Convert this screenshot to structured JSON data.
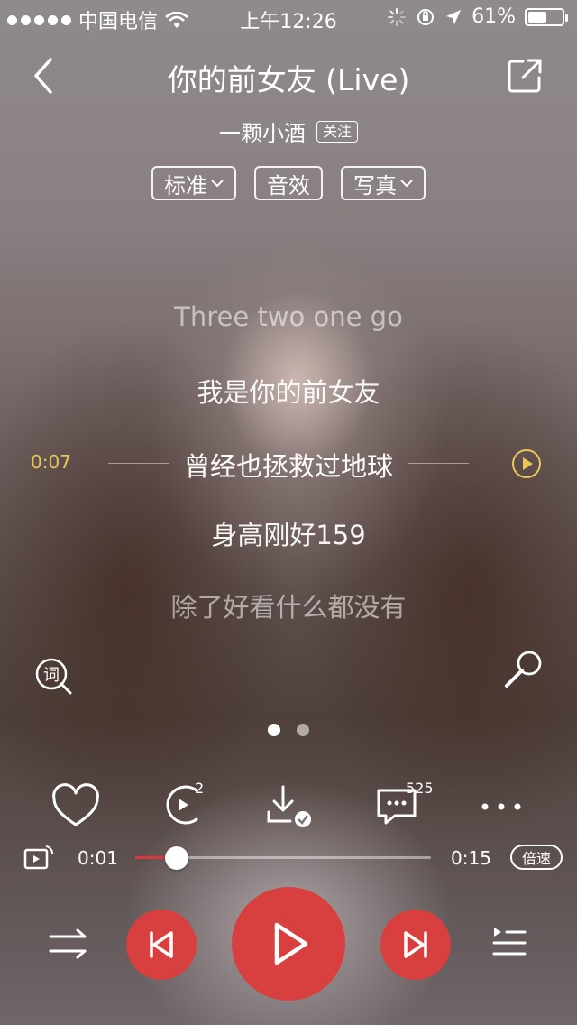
{
  "status_bar": {
    "carrier": "中国电信",
    "time": "上午12:26",
    "battery": "61%",
    "battery_level": 0.61
  },
  "header": {
    "title": "你的前女友 (Live)",
    "artist": "一颗小酒",
    "follow_label": "关注"
  },
  "options": {
    "quality_label": "标准",
    "effect_label": "音效",
    "photo_label": "写真"
  },
  "lyrics": {
    "line1": "Three two one go",
    "line2": "我是你的前女友",
    "line3": "曾经也拯救过地球",
    "line4": "身高刚好159",
    "line5": "除了好看什么都没有",
    "seek_time": "0:07"
  },
  "actions": {
    "share_count": "2",
    "comment_count": "525"
  },
  "progress": {
    "current": "0:01",
    "total": "0:15",
    "fraction": 0.14,
    "speed_label": "倍速"
  },
  "pager": {
    "pages": 2,
    "active": 0
  },
  "colors": {
    "accent": "#d83f3f",
    "seek_time": "#e6c85a"
  }
}
